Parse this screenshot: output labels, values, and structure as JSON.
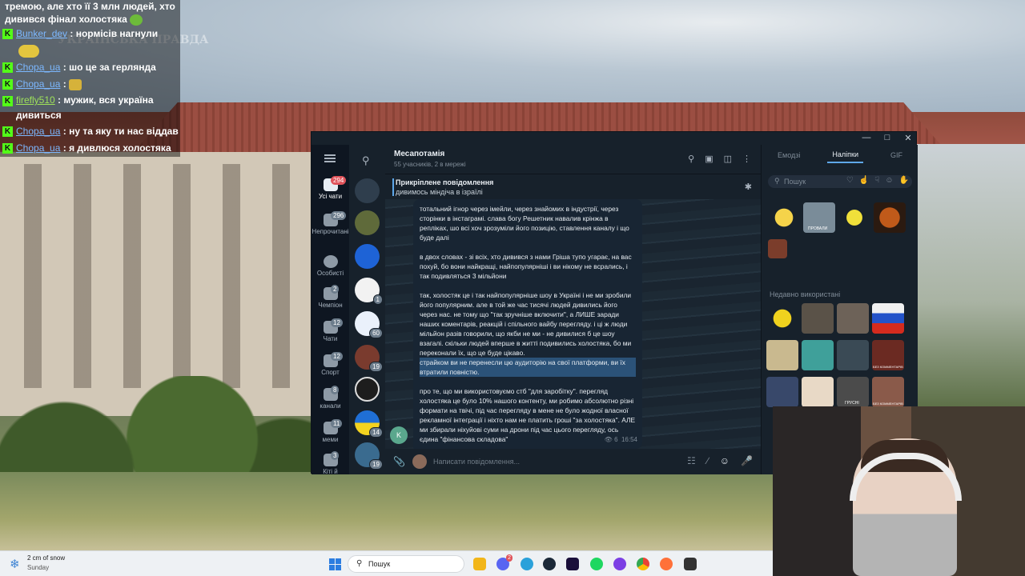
{
  "chat_overlay": {
    "top_line": "тремою, але хто її 3 млн людей, хто дивився фінал холостяка",
    "messages": [
      {
        "user": "Bunker_dev",
        "text": ": нормісів нагнули"
      },
      {
        "user": "Chopa_ua",
        "text": ": шо це за герлянда"
      },
      {
        "user": "Chopa_ua",
        "text": ":"
      },
      {
        "user": "firefly510",
        "text": ": мужик, вся україна дивиться"
      },
      {
        "user": "Chopa_ua",
        "text": ": ну та яку ти нас віддав"
      },
      {
        "user": "Chopa_ua",
        "text": ": я дивлюся холостяка"
      }
    ],
    "badge": "K",
    "badge_color": "#53fc18"
  },
  "telegram": {
    "nav": {
      "items": [
        {
          "label": "Усі чати",
          "badge": "294",
          "icon": "chat-bubbles-icon"
        },
        {
          "label": "Непрочитані",
          "badge": "296",
          "icon": "unread-chat-icon"
        },
        {
          "label": "Особисті",
          "badge": "",
          "icon": "person-icon"
        },
        {
          "label": "Чемпіон",
          "badge": "2",
          "icon": "folder-chat-icon"
        },
        {
          "label": "Чати",
          "badge": "12",
          "icon": "folder-chat-icon"
        },
        {
          "label": "Спорт",
          "badge": "12",
          "icon": "folder-chat-icon"
        },
        {
          "label": "канали",
          "badge": "8",
          "icon": "folder-chat-icon"
        },
        {
          "label": "меми",
          "badge": "11",
          "icon": "folder-chat-icon"
        },
        {
          "label": "Кіті й",
          "badge": "3",
          "icon": "folder-chat-icon"
        }
      ]
    },
    "chat_list_badges": [
      "",
      "",
      "1",
      "60",
      "19",
      "",
      "14",
      "19"
    ],
    "conversation": {
      "title": "Месапотамія",
      "subtitle": "55 учасників, 2 в мережі",
      "pinned_title": "Прикріплене повідомлення",
      "pinned_text": "дивимось міндіча в ізраїлі",
      "message_paragraphs": [
        "тотальний ігнор через імейли, через знайомих в індустрії, через сторінки в інстаграмі. слава богу Решетник навалив крінжа в репліках, шо всі хоч зрозуміли його позицію, ставлення каналу і що буде далі",
        "в двох словах - зі всіх, хто дивився з нами Гріша тупо угарає, на вас похуй, бо вони найкращі, найпопулярніші і ви нікому не всрались, і так подивляться 3 мільйони",
        "так, холостяк це і так найпопулярніше шоу в Україні і не ми зробили його популярним. але в той же час тисячі людей дивились його через нас. не тому що \"так зручніше включити\", а ЛИШЕ заради наших коментарів, реакцій і спільного вайбу перегляду. і ці ж люди мільйон разів говорили, що якби не ми - не дивилися б це шоу взагалі. скільки людей вперше в житті подивились холостяка, бо ми переконали їх, що це буде цікаво."
      ],
      "highlighted_text": "страйком ви не перенесли цю аудиторію на свої платформи, ви їх втратили повністю.",
      "last_paragraph": "про те, що ми використовуємо стб \"для заробітку\". перегляд холостяка це було 10% нашого контенту, ми робимо абсолютно різні формати на твічі, під час перегляду в мене не було жодної власної рекламної інтеграції і ніхто нам не платить гроші \"за холостяка\". АЛЕ ми збирали ніхуйові суми на дрони під час цього перегляду, ось єдина \"фінансова складова\"",
      "views": "6",
      "time": "16:54",
      "sender_initial": "K",
      "composer_placeholder": "Написати повідомлення..."
    },
    "panel": {
      "tabs": [
        "Емодзі",
        "Наліпки",
        "GIF"
      ],
      "active_tab": "Наліпки",
      "search_placeholder": "Пошук",
      "recent_label": "Недавно використані",
      "sticker_captions": [
        "ПРОВАЛИ",
        "БЕЗ КОММЕНТАРІВ",
        "ГРУСНІ",
        "БЕЗ КОММЕНТАРІВ"
      ]
    }
  },
  "taskbar": {
    "weather_line1": "2 cm of snow",
    "weather_line2": "Sunday",
    "search_label": "Пошук",
    "telegram_badge": "2",
    "accent": "#2b7de0"
  },
  "watermark": "УКРАЇНСЬКА ПРАВДА"
}
